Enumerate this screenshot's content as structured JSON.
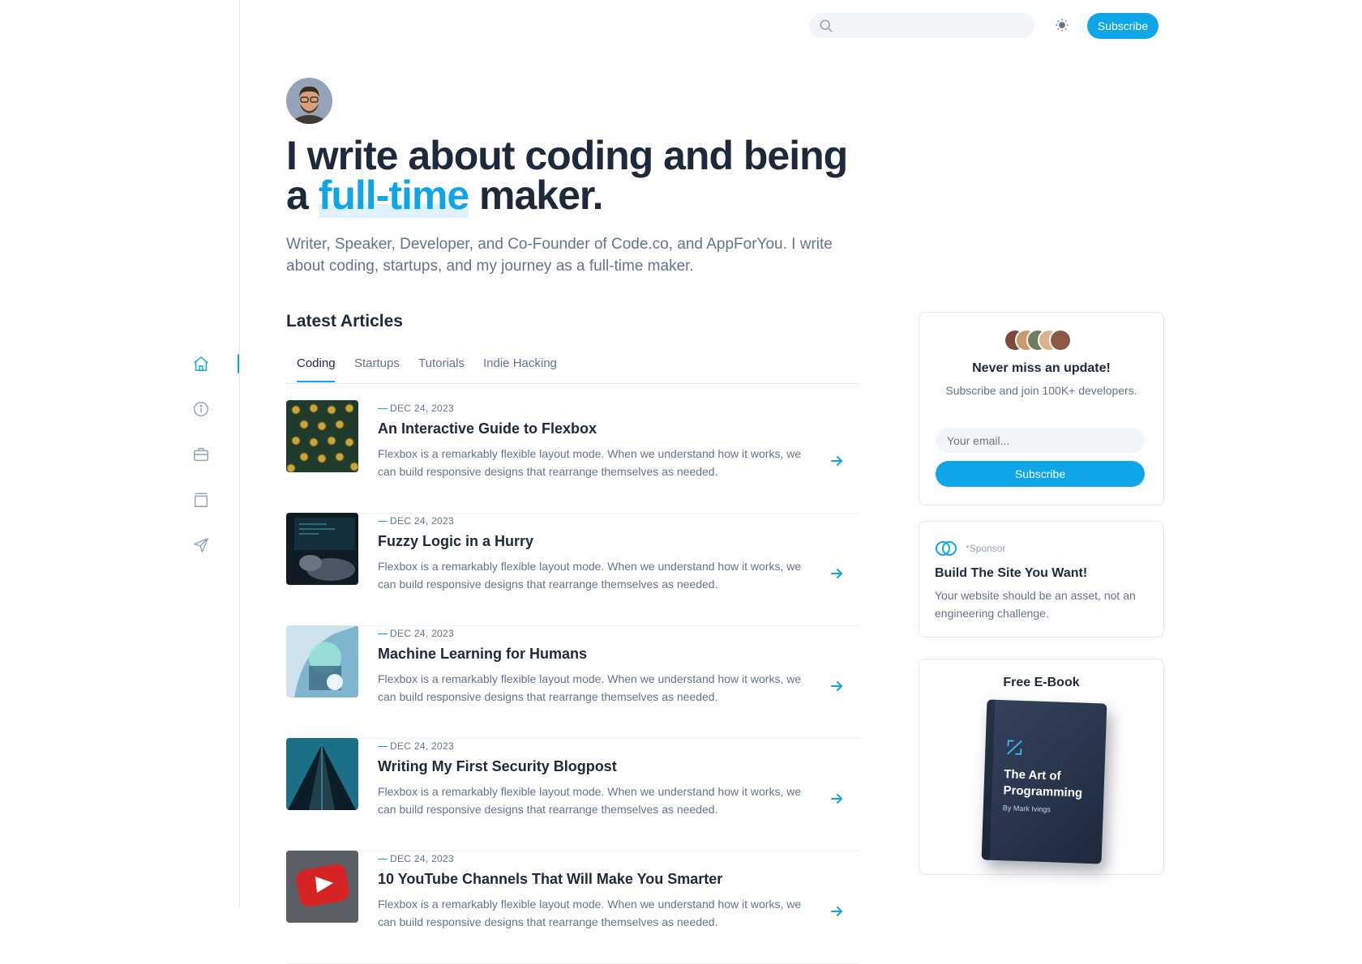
{
  "header": {
    "search_placeholder": "",
    "subscribe_label": "Subscribe"
  },
  "sidebar": {
    "items": [
      {
        "name": "home-icon",
        "active": true
      },
      {
        "name": "info-icon",
        "active": false
      },
      {
        "name": "briefcase-icon",
        "active": false
      },
      {
        "name": "archive-icon",
        "active": false
      },
      {
        "name": "send-icon",
        "active": false
      }
    ]
  },
  "hero": {
    "title_part1": "I write about coding and being",
    "title_part2_prefix": "a ",
    "title_highlight": "full-time",
    "title_part2_suffix": " maker.",
    "subtitle": "Writer, Speaker, Developer, and Co-Founder of Code.co, and AppForYou. I write about coding, startups, and my journey as a full-time maker."
  },
  "latest": {
    "title": "Latest Articles",
    "tabs": [
      "Coding",
      "Startups",
      "Tutorials",
      "Indie Hacking"
    ],
    "active_tab": "Coding",
    "articles": [
      {
        "date": "DEC 24, 2023",
        "title": "An Interactive Guide to Flexbox",
        "excerpt": "Flexbox is a remarkably flexible layout mode. When we understand how it works, we can build responsive designs that rearrange themselves as needed."
      },
      {
        "date": "DEC 24, 2023",
        "title": "Fuzzy Logic in a Hurry",
        "excerpt": "Flexbox is a remarkably flexible layout mode. When we understand how it works, we can build responsive designs that rearrange themselves as needed."
      },
      {
        "date": "DEC 24, 2023",
        "title": "Machine Learning for Humans",
        "excerpt": "Flexbox is a remarkably flexible layout mode. When we understand how it works, we can build responsive designs that rearrange themselves as needed."
      },
      {
        "date": "DEC 24, 2023",
        "title": "Writing My First Security Blogpost",
        "excerpt": "Flexbox is a remarkably flexible layout mode. When we understand how it works, we can build responsive designs that rearrange themselves as needed."
      },
      {
        "date": "DEC 24, 2023",
        "title": "10 YouTube Channels That Will Make You Smarter",
        "excerpt": "Flexbox is a remarkably flexible layout mode. When we understand how it works, we can build responsive designs that rearrange themselves as needed."
      }
    ]
  },
  "newsletter": {
    "title": "Never miss an update!",
    "subtitle": "Subscribe and join 100K+ developers.",
    "email_placeholder": "Your email...",
    "button_label": "Subscribe"
  },
  "sponsor": {
    "tag": "*Sponsor",
    "title": "Build The Site You Want!",
    "description": "Your website should be an asset, not an engineering challenge."
  },
  "ebook": {
    "title": "Free E-Book",
    "book_title": "The Art of Programming",
    "book_author": "By Mark Ivings"
  },
  "colors": {
    "accent": "#0ea5e9",
    "heading": "#1e293b",
    "muted": "#64748b"
  }
}
